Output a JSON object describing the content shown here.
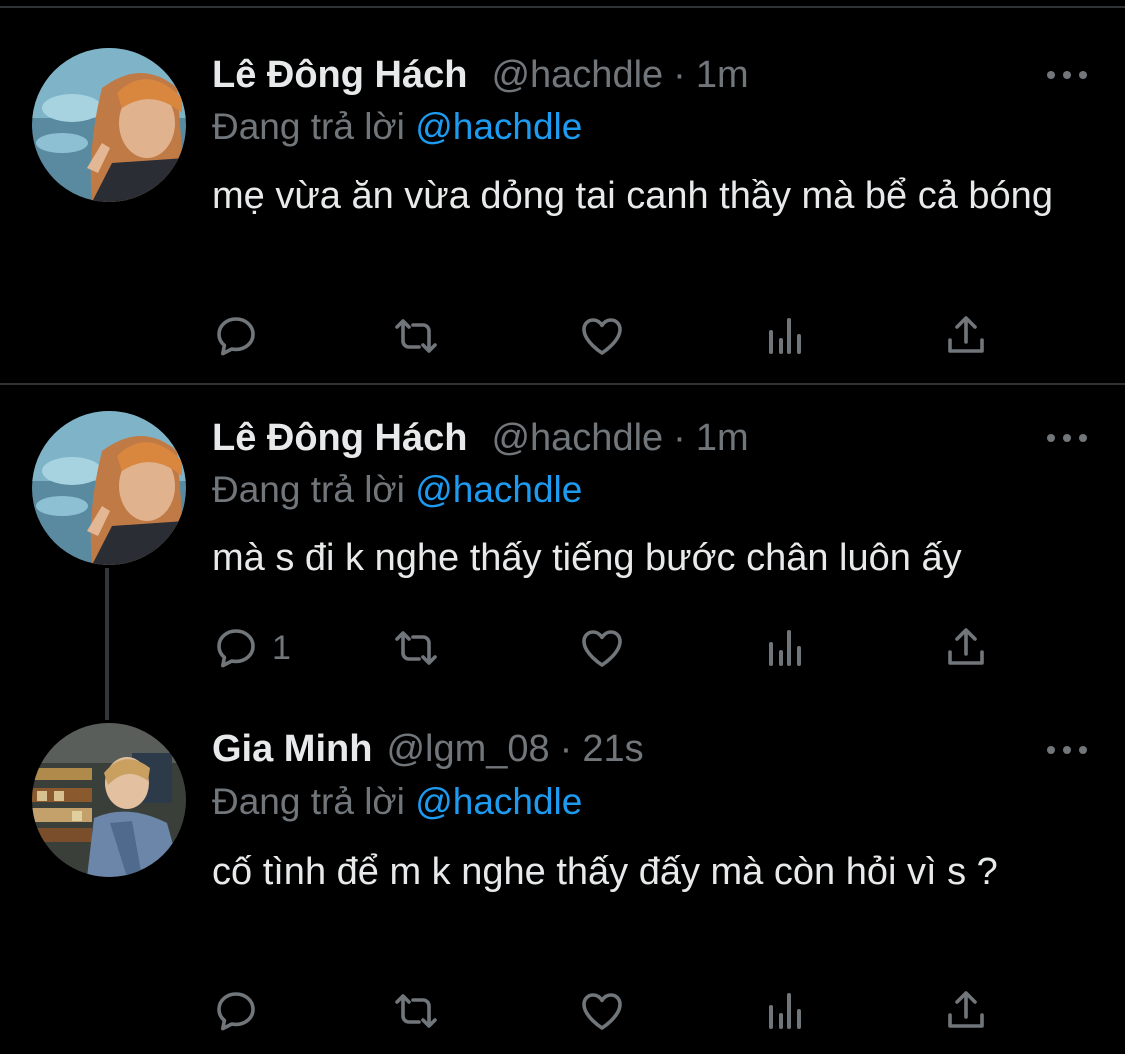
{
  "tweets": [
    {
      "name": "Lê Đông Hách",
      "handle": "@hachdle",
      "separator": "·",
      "time": "1m",
      "reply_prefix": "Đang trả lời",
      "reply_to": "@hachdle",
      "text": "mẹ vừa ăn vừa dỏng tai canh thầy mà bể cả bóng",
      "reply_count": "",
      "icons": [
        "reply-icon",
        "retweet-icon",
        "like-icon",
        "analytics-icon",
        "share-icon"
      ]
    },
    {
      "name": "Lê Đông Hách",
      "handle": "@hachdle",
      "separator": "·",
      "time": "1m",
      "reply_prefix": "Đang trả lời",
      "reply_to": "@hachdle",
      "text": "mà s đi k nghe thấy tiếng bước chân luôn ấy",
      "reply_count": "1",
      "icons": [
        "reply-icon",
        "retweet-icon",
        "like-icon",
        "analytics-icon",
        "share-icon"
      ]
    },
    {
      "name": "Gia Minh",
      "handle": "@lgm_08",
      "separator": "·",
      "time": "21s",
      "reply_prefix": "Đang trả lời",
      "reply_to": "@hachdle",
      "text": "cố tình để m k nghe thấy đấy mà còn hỏi vì s ?",
      "reply_count": "",
      "icons": [
        "reply-icon",
        "retweet-icon",
        "like-icon",
        "analytics-icon",
        "share-icon"
      ]
    }
  ],
  "colors": {
    "background": "#000000",
    "primary_text": "#e7e9ea",
    "secondary_text": "#71767b",
    "accent": "#1d9bf0",
    "divider": "#2f3336"
  }
}
